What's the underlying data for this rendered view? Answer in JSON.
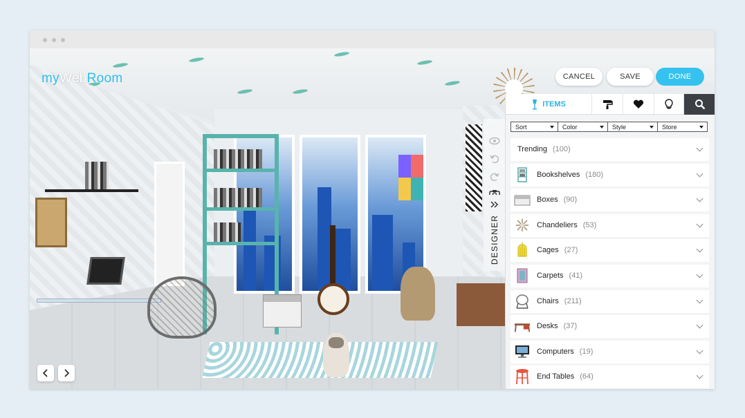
{
  "app": {
    "logo_part1": "my",
    "logo_part2": "Web",
    "logo_part3": "Room"
  },
  "header": {
    "cancel_label": "CANCEL",
    "save_label": "SAVE",
    "done_label": "DONE",
    "done_color": "#35c2ef"
  },
  "sidebar_tools": {
    "designer_label": "DESIGNER",
    "icons": [
      "eye-icon",
      "undo-icon",
      "redo-icon",
      "camera-icon",
      "double-chevron-right-icon"
    ]
  },
  "panel": {
    "tabs": [
      {
        "label": "ITEMS",
        "icon": "lamp-icon",
        "active": true
      },
      {
        "icon": "paint-roller-icon"
      },
      {
        "icon": "heart-icon"
      },
      {
        "icon": "lightbulb-icon"
      },
      {
        "icon": "search-icon"
      }
    ],
    "filters": [
      "Sort",
      "Color",
      "Style",
      "Store"
    ],
    "categories": [
      {
        "name": "Trending",
        "count": "(100)",
        "icon": ""
      },
      {
        "name": "Bookshelves",
        "count": "(180)",
        "icon": "bookshelf-icon"
      },
      {
        "name": "Boxes",
        "count": "(90)",
        "icon": "box-icon"
      },
      {
        "name": "Chandeliers",
        "count": "(53)",
        "icon": "chandelier-icon"
      },
      {
        "name": "Cages",
        "count": "(27)",
        "icon": "birdcage-icon"
      },
      {
        "name": "Carpets",
        "count": "(41)",
        "icon": "carpet-icon"
      },
      {
        "name": "Chairs",
        "count": "(211)",
        "icon": "chair-icon"
      },
      {
        "name": "Desks",
        "count": "(37)",
        "icon": "desk-icon"
      },
      {
        "name": "Computers",
        "count": "(19)",
        "icon": "computer-icon"
      },
      {
        "name": "End Tables",
        "count": "(64)",
        "icon": "end-table-icon"
      }
    ],
    "accent": "#2fb3e0"
  },
  "room_nav": {
    "prev_icon": "chevron-left-icon",
    "next_icon": "chevron-right-icon"
  }
}
